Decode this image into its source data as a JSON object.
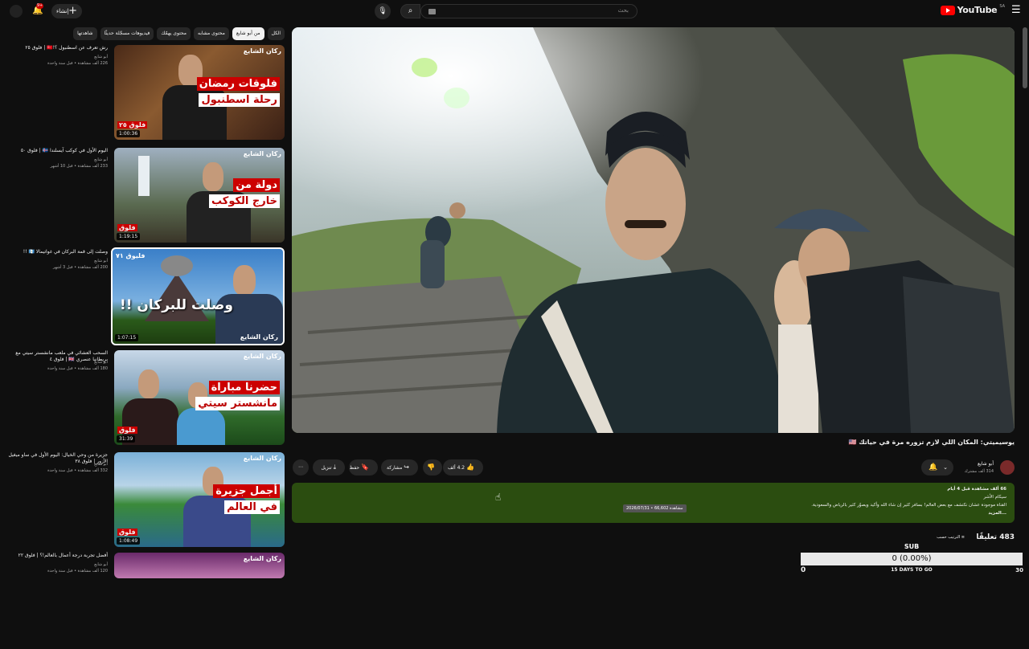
{
  "header": {
    "logo_text": "YouTube",
    "logo_region": "SA",
    "search_placeholder": "بحث",
    "create_label": "إنشاء",
    "notification_count": "9+"
  },
  "chips": [
    "الكل",
    "من أبو شايع",
    "محتوى مشابه",
    "محتوى يهمّك",
    "فيديوهات مسجّلة حديثًا",
    "شاهدتها"
  ],
  "related": [
    {
      "title": "رش تعرف عن اسطنبول ؟!🇹🇷 | فلوق ٢٥",
      "channel": "أبو شايع",
      "meta": "226 ألف مشاهدة • قبل سنة واحدة",
      "duration": "1:00:36",
      "caption1": "فلوقات رمضان",
      "caption2": "رحلة اسطنبول",
      "brand": "ركان الشايع",
      "ep": "فلوق ٢٥"
    },
    {
      "title": "اليوم الأول في كوكب آيسلندا 🇮🇸 | فلوق ٥٠",
      "channel": "أبو شايع",
      "meta": "233 ألف مشاهدة • قبل 10 أشهر",
      "duration": "1:19:15",
      "caption1": "دولة من",
      "caption2": "خارج الكوكب",
      "brand": "ركان الشايع",
      "ep": "فلوق"
    },
    {
      "title": "وصلت إلى قمة البركان في غواتيمالا 🇬🇹 !!",
      "channel": "أبو شايع",
      "meta": "200 ألف مشاهدة • قبل 3 أشهر",
      "duration": "1:07:15",
      "caption1": "وصلت للبركان !!",
      "caption2": "",
      "brand": "ركان الشايع",
      "ep": "فليوق ٧١"
    },
    {
      "title": "السحب العشائي في ملعب مانشستر سيتي مع بريطانيا عنصري 🇬🇧 | فلوق ٤",
      "channel": "أبو شايع",
      "meta": "180 ألف مشاهدة • قبل سنة واحدة",
      "duration": "31:39",
      "caption1": "حضرنا مباراة",
      "caption2": "مانشستر سيتي",
      "brand": "ركان الشايع",
      "ep": "فلوق"
    },
    {
      "title": "جزيرة من وحي الخيال: اليوم الأول في ساو ميغيل الأزور | فلوق ٣٨",
      "channel": "أبو شايع",
      "meta": "332 ألف مشاهدة • قبل سنة واحدة",
      "duration": "1:08:49",
      "caption1": "أجمل جزيرة",
      "caption2": "في العالم",
      "brand": "ركان الشايع",
      "ep": "فلوق"
    },
    {
      "title": "أفضل تجربة درجة أعمال بالعالم!؟ | فلوق ٢٢",
      "channel": "أبو شايع",
      "meta": "120 ألف مشاهدة • قبل سنة واحدة",
      "duration": "",
      "caption1": "",
      "caption2": "",
      "brand": "ركان الشايع",
      "ep": ""
    }
  ],
  "video": {
    "title": "يوسيميتي: المكان اللي لازم تزوره مرة في حياتك 🇺🇸",
    "channel": "أبو شايع",
    "subscribers": "314 ألف مشترك",
    "likes": "4.2 ألف",
    "share_label": "مشاركة",
    "save_label": "حفظ",
    "download_label": "تنزيل"
  },
  "description": {
    "stats": "66 ألف مشاهدة قبل 4 أيام",
    "line2": "سيكام الأشر",
    "line3": "القناة موجودة عشان نكتشف مع بعض العالم! بسافر كثير إن شاء الله وأكيد ويصوّر كثير بالرياض والسعودية.",
    "more": "...المزيد",
    "tooltip": "2026/07/31 • 66,602 مشاهدة"
  },
  "comments": {
    "count": "483 تعليقًا",
    "sort_label": "الترتيب حسب"
  },
  "sub_widget": {
    "label": "SUB",
    "value": "0 (0.00%)",
    "min": "0",
    "max": "30",
    "days": "15 DAYS TO GO",
    "fraction": 0
  },
  "colors": {
    "brand_red": "#ff0000",
    "description_bg": "#2b4d10",
    "background": "#0f0f0f"
  }
}
